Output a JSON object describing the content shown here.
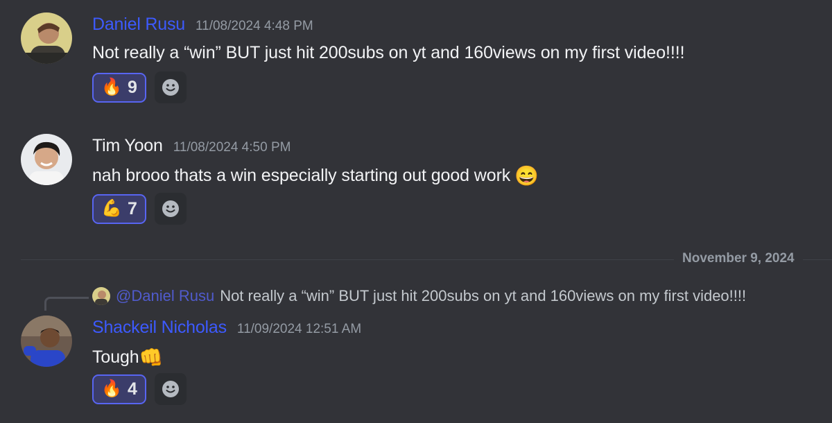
{
  "messages": [
    {
      "author": "Daniel Rusu",
      "author_color": "#3d5afe",
      "timestamp": "11/08/2024 4:48 PM",
      "content": "Not really a “win” BUT just hit 200subs on yt and 160views on my first video!!!!",
      "reaction": {
        "emoji": "🔥",
        "icon": "fire-icon",
        "count": "9"
      }
    },
    {
      "author": "Tim Yoon",
      "author_color": "#f2f3f5",
      "timestamp": "11/08/2024 4:50 PM",
      "content": "nah brooo thats a win especially starting out good work",
      "content_emoji": "😄",
      "reaction": {
        "emoji": "💪",
        "icon": "flexed-biceps-icon",
        "count": "7"
      }
    },
    {
      "author": "Shackeil Nicholas",
      "author_color": "#3d5afe",
      "timestamp": "11/09/2024 12:51 AM",
      "content": "Tough",
      "content_emoji": "👊",
      "reply": {
        "mention": "@Daniel Rusu",
        "text": "Not really a “win” BUT just hit 200subs on yt and 160views on my first video!!!!"
      },
      "reaction": {
        "emoji": "🔥",
        "icon": "fire-icon",
        "count": "4"
      }
    }
  ],
  "date_divider": "November 9, 2024",
  "colors": {
    "background": "#323338",
    "reaction_border": "#5865f2",
    "reaction_bg": "#3b3d6a",
    "timestamp": "#949ba4"
  }
}
